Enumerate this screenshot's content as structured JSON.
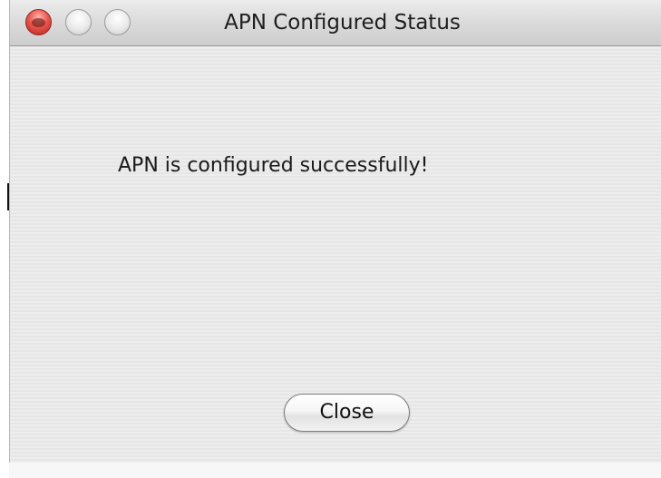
{
  "window": {
    "title": "APN Configured Status"
  },
  "dialog": {
    "message": "APN is configured successfully!",
    "close_label": "Close"
  },
  "icons": {
    "close_window": "close-window-icon",
    "minimize_window": "minimize-window-icon",
    "zoom_window": "zoom-window-icon"
  },
  "colors": {
    "close_traffic_light": "#e8574e",
    "inactive_traffic_light": "#e9e9e9",
    "window_background": "#ececec"
  }
}
